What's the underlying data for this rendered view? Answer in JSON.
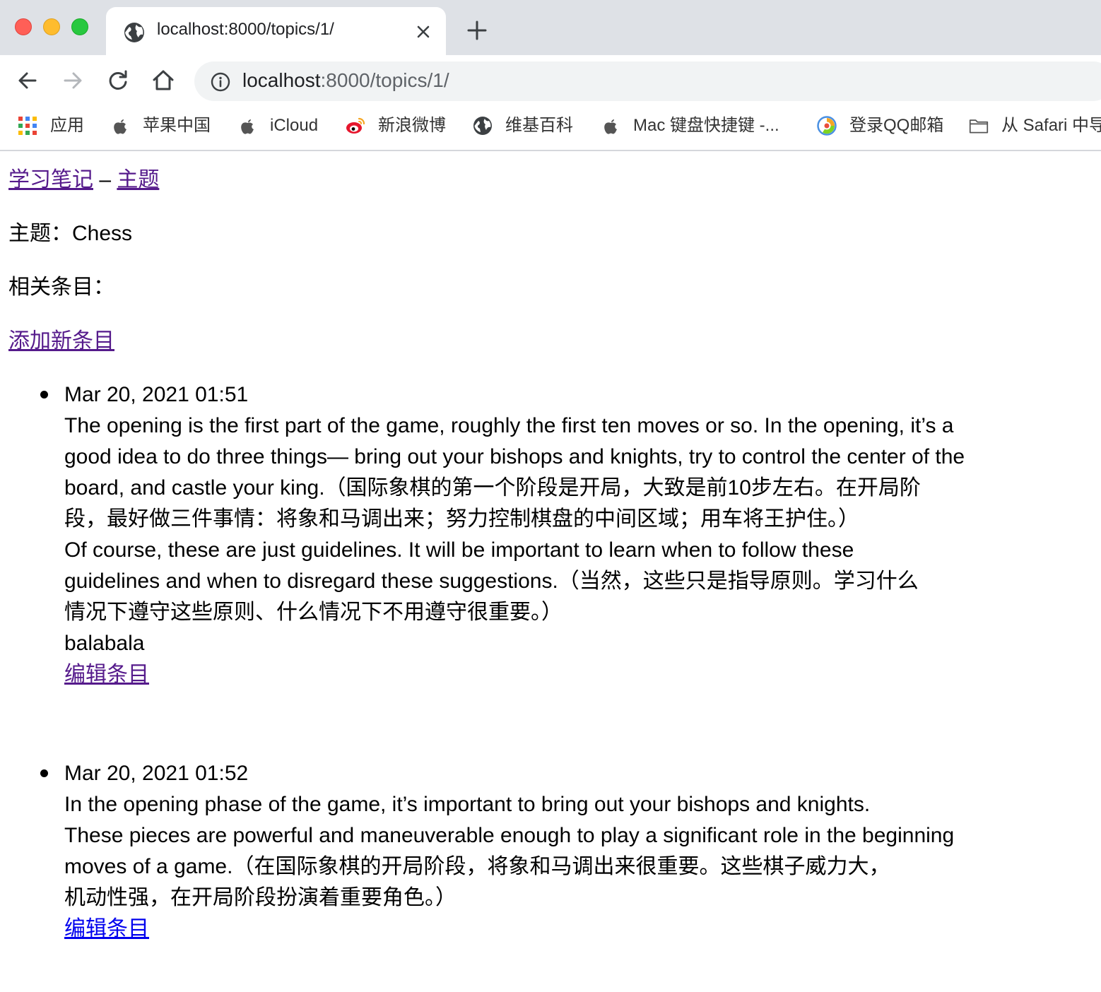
{
  "browser": {
    "tab": {
      "title": "localhost:8000/topics/1/"
    },
    "address": {
      "host": "localhost",
      "rest": ":8000/topics/1/"
    },
    "bookmarks": [
      {
        "label": "应用",
        "icon": "apps-grid-icon"
      },
      {
        "label": "苹果中国",
        "icon": "apple-icon"
      },
      {
        "label": "iCloud",
        "icon": "apple-icon"
      },
      {
        "label": "新浪微博",
        "icon": "weibo-icon"
      },
      {
        "label": "维基百科",
        "icon": "globe-icon"
      },
      {
        "label": "Mac 键盘快捷键 -...",
        "icon": "apple-icon"
      },
      {
        "label": "登录QQ邮箱",
        "icon": "qq-mail-icon"
      },
      {
        "label": "从 Safari 中导",
        "icon": "folder-icon"
      }
    ]
  },
  "page": {
    "site_link": "学习笔记",
    "separator": " – ",
    "topics_link": "主题",
    "topic_label": "主题：Chess",
    "related_label": "相关条目：",
    "add_entry_link": "添加新条目",
    "entries": [
      {
        "date": "Mar 20, 2021 01:51",
        "lines": [
          "The opening is the first part of the game, roughly the first ten moves or so. In the opening, it’s a",
          "good idea to do three things— bring out your bishops and knights, try to control the center of the",
          "board, and castle your king.（国际象棋的第一个阶段是开局，大致是前10步左右。在开局阶",
          "段，最好做三件事情：将象和马调出来；努力控制棋盘的中间区域；用车将王护住。）",
          "Of course, these are just guidelines. It will be important to learn when to follow these",
          "guidelines and when to disregard these suggestions.（当然，这些只是指导原则。学习什么",
          "情况下遵守这些原则、什么情况下不用遵守很重要。）",
          "balabala"
        ],
        "edit_link": "编辑条目"
      },
      {
        "date": "Mar 20, 2021 01:52",
        "lines": [
          "In the opening phase of the game, it’s important to bring out your bishops and knights.",
          "These pieces are powerful and maneuverable enough to play a significant role in the beginning",
          "moves of a game.（在国际象棋的开局阶段，将象和马调出来很重要。这些棋子威力大，",
          "机动性强，在开局阶段扮演着重要角色。）"
        ],
        "edit_link": "编辑条目"
      }
    ]
  }
}
